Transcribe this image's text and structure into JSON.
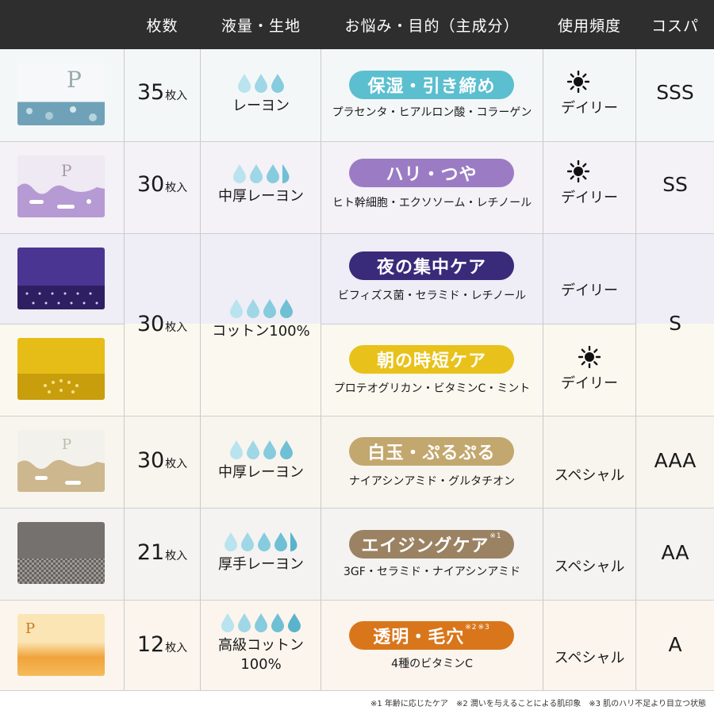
{
  "header": {
    "count": "枚数",
    "fabric": "液量・生地",
    "purpose": "お悩み・目的（主成分）",
    "frequency": "使用頻度",
    "value": "コスパ"
  },
  "rows": [
    {
      "count": "35",
      "unit": "枚入",
      "drops_full": 3,
      "drops_half": 0,
      "fabric": "レーヨン",
      "purpose": "保湿・引き締め",
      "purpose_color": "#5bbfcf",
      "ingredients": "プラセンタ・ヒアルロン酸・コラーゲン",
      "icons": [
        "sun-icon",
        "moon-icon"
      ],
      "frequency": "デイリー",
      "value": "SSS",
      "pack_color": "#e9eef0"
    },
    {
      "count": "30",
      "unit": "枚入",
      "drops_full": 3,
      "drops_half": 1,
      "fabric": "中厚レーヨン",
      "purpose": "ハリ・つや",
      "purpose_color": "#9b7cc4",
      "ingredients": "ヒト幹細胞・エクソソーム・レチノール",
      "icons": [
        "sun-icon",
        "moon-icon"
      ],
      "frequency": "デイリー",
      "value": "SS",
      "pack_color": "#b89fd6"
    },
    {
      "count": "30",
      "unit": "枚入",
      "drops_full": 4,
      "drops_half": 0,
      "fabric": "コットン100%",
      "purpose": "夜の集中ケア",
      "purpose_color": "#3a2a7a",
      "ingredients": "ビフィズス菌・セラミド・レチノール",
      "icons": [
        "moon-icon"
      ],
      "frequency": "デイリー",
      "value": "S",
      "pack_color": "#3f2b82"
    },
    {
      "purpose": "朝の時短ケア",
      "purpose_color": "#e8c21a",
      "ingredients": "プロテオグリカン・ビタミンC・ミント",
      "icons": [
        "sun-icon"
      ],
      "frequency": "デイリー",
      "pack_color": "#e2b81a"
    },
    {
      "count": "30",
      "unit": "枚入",
      "drops_full": 4,
      "drops_half": 0,
      "fabric": "中厚レーヨン",
      "purpose": "白玉・ぷるぷる",
      "purpose_color": "#c2a76e",
      "ingredients": "ナイアシンアミド・グルタチオン",
      "icons": [
        "moon-icon"
      ],
      "frequency": "スペシャル",
      "value": "AAA",
      "pack_color": "#d8c7a4"
    },
    {
      "count": "21",
      "unit": "枚入",
      "drops_full": 4,
      "drops_half": 1,
      "fabric": "厚手レーヨン",
      "purpose": "エイジングケア",
      "purpose_sup": "※1",
      "purpose_color": "#9a8263",
      "ingredients": "3GF・セラミド・ナイアシンアミド",
      "icons": [
        "moon-icon"
      ],
      "frequency": "スペシャル",
      "value": "AA",
      "pack_color": "#6e6b69"
    },
    {
      "count": "12",
      "unit": "枚入",
      "drops_full": 5,
      "drops_half": 0,
      "fabric": "高級コットン100%",
      "purpose": "透明・毛穴",
      "purpose_sup1": "※2",
      "purpose_sup2": "※3",
      "purpose_color": "#d9761c",
      "ingredients": "4種のビタミンC",
      "icons": [
        "moon-icon"
      ],
      "frequency": "スペシャル",
      "value": "A",
      "pack_color": "#f0a83a"
    }
  ],
  "footnotes": [
    "※1 年齢に応じたケア",
    "※2 潤いを与えることによる肌印象",
    "※3 肌のハリ不足より目立つ状態"
  ]
}
